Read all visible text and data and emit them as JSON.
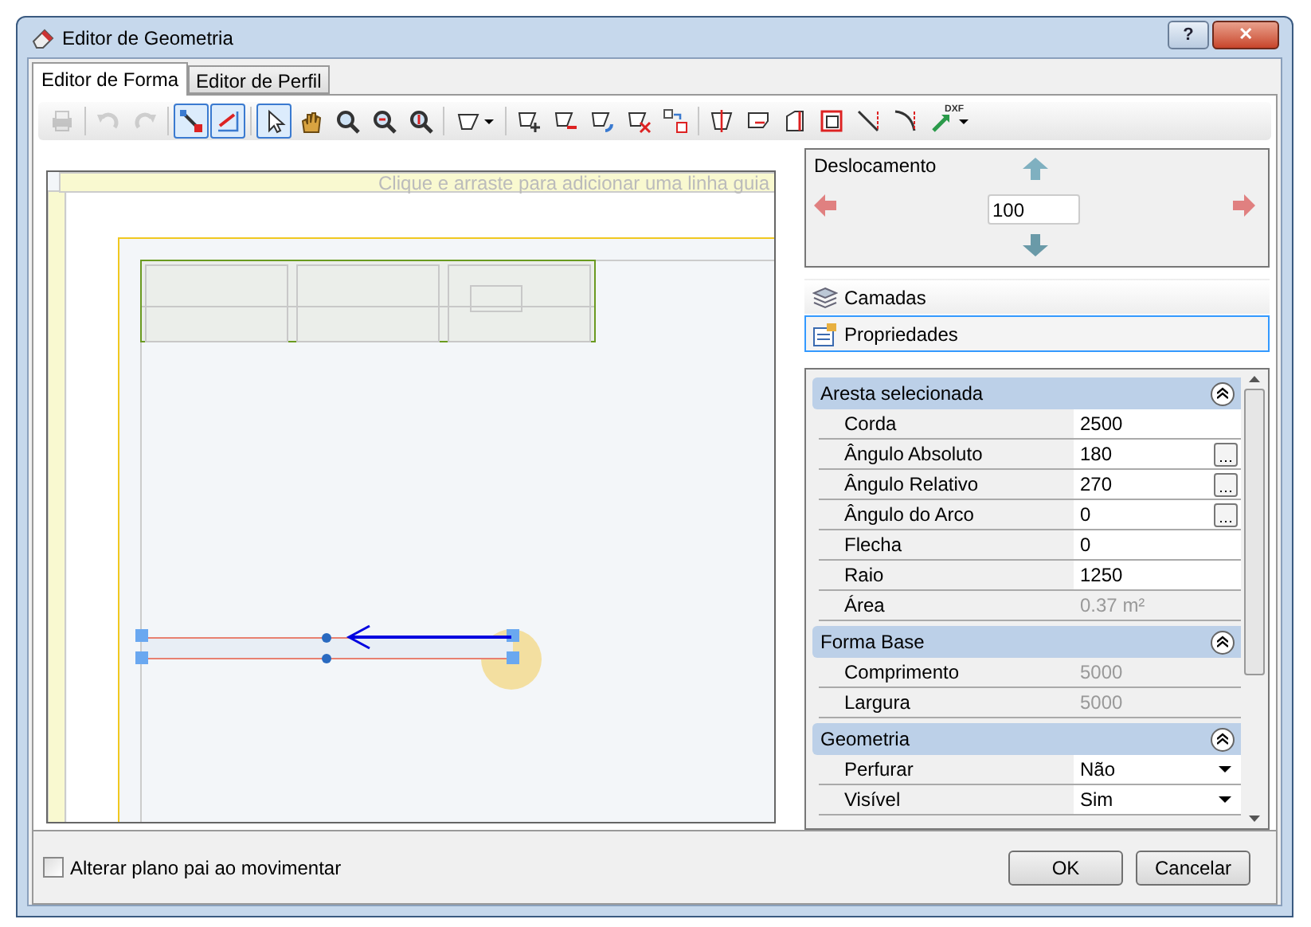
{
  "window": {
    "title": "Editor de Geometria",
    "buttons": [
      {
        "kind": "help",
        "label": "?"
      },
      {
        "kind": "close",
        "label": "✕"
      }
    ]
  },
  "tabs": [
    {
      "label": "Editor de Forma",
      "selected": true
    },
    {
      "label": "Editor de Perfil",
      "selected": false
    }
  ],
  "toolbar": [
    {
      "kind": "print",
      "selected": false,
      "disabled": true
    },
    {
      "kind": "separator"
    },
    {
      "kind": "undo",
      "selected": false,
      "disabled": true
    },
    {
      "kind": "redo",
      "selected": false,
      "disabled": true
    },
    {
      "kind": "separator"
    },
    {
      "kind": "snap-point",
      "selected": true,
      "disabled": false
    },
    {
      "kind": "snap-edge",
      "selected": true,
      "disabled": false
    },
    {
      "kind": "separator"
    },
    {
      "kind": "pointer",
      "selected": true,
      "disabled": false
    },
    {
      "kind": "pan",
      "selected": false,
      "disabled": false
    },
    {
      "kind": "zoom",
      "selected": false,
      "disabled": false
    },
    {
      "kind": "zoom-out",
      "selected": false,
      "disabled": false
    },
    {
      "kind": "zoom-fit",
      "selected": false,
      "disabled": false
    },
    {
      "kind": "separator"
    },
    {
      "kind": "shape-menu",
      "selected": false,
      "disabled": false
    },
    {
      "kind": "separator"
    },
    {
      "kind": "add-vertex",
      "selected": false,
      "disabled": false
    },
    {
      "kind": "remove-vertex",
      "selected": false,
      "disabled": false
    },
    {
      "kind": "rotate",
      "selected": false,
      "disabled": false
    },
    {
      "kind": "delete-edge",
      "selected": false,
      "disabled": false
    },
    {
      "kind": "move",
      "selected": false,
      "disabled": false
    },
    {
      "kind": "separator"
    },
    {
      "kind": "split",
      "selected": false,
      "disabled": false
    },
    {
      "kind": "chamfer",
      "selected": false,
      "disabled": false
    },
    {
      "kind": "cut",
      "selected": false,
      "disabled": false
    },
    {
      "kind": "offset",
      "selected": false,
      "disabled": false
    },
    {
      "kind": "diagonal",
      "selected": false,
      "disabled": false
    },
    {
      "kind": "arc",
      "selected": false,
      "disabled": false
    },
    {
      "kind": "dxf",
      "label": "DXF",
      "selected": false,
      "disabled": false
    }
  ],
  "canvas": {
    "ruler_hint": "Clique e arraste para adicionar uma linha guia"
  },
  "offset_panel": {
    "title": "Deslocamento",
    "value": "100"
  },
  "panels": [
    {
      "label": "Camadas",
      "kind": "layers",
      "selected": false
    },
    {
      "label": "Propriedades",
      "kind": "properties",
      "selected": true
    }
  ],
  "property_groups": [
    {
      "title": "Aresta selecionada",
      "expanded": true,
      "rows": [
        {
          "label": "Corda",
          "value": "2500",
          "kind": "text",
          "readonly": false
        },
        {
          "label": "Ângulo Absoluto",
          "value": "180",
          "kind": "ellipsis",
          "readonly": false
        },
        {
          "label": "Ângulo Relativo",
          "value": "270",
          "kind": "ellipsis",
          "readonly": false
        },
        {
          "label": "Ângulo do Arco",
          "value": "0",
          "kind": "ellipsis",
          "readonly": false
        },
        {
          "label": "Flecha",
          "value": "0",
          "kind": "text",
          "readonly": false
        },
        {
          "label": "Raio",
          "value": "1250",
          "kind": "text",
          "readonly": false
        },
        {
          "label": "Área",
          "value": "0.37 m²",
          "kind": "text",
          "readonly": true
        }
      ]
    },
    {
      "title": "Forma Base",
      "expanded": true,
      "rows": [
        {
          "label": "Comprimento",
          "value": "5000",
          "kind": "text",
          "readonly": true
        },
        {
          "label": "Largura",
          "value": "5000",
          "kind": "text",
          "readonly": true
        }
      ]
    },
    {
      "title": "Geometria",
      "expanded": true,
      "rows": [
        {
          "label": "Perfurar",
          "value": "Não",
          "kind": "dropdown",
          "readonly": false
        },
        {
          "label": "Visível",
          "value": "Sim",
          "kind": "dropdown",
          "readonly": false
        }
      ]
    }
  ],
  "footer": {
    "checkbox": {
      "label": "Alterar plano pai ao movimentar",
      "checked": false
    },
    "buttons": [
      "OK",
      "Cancelar"
    ]
  }
}
